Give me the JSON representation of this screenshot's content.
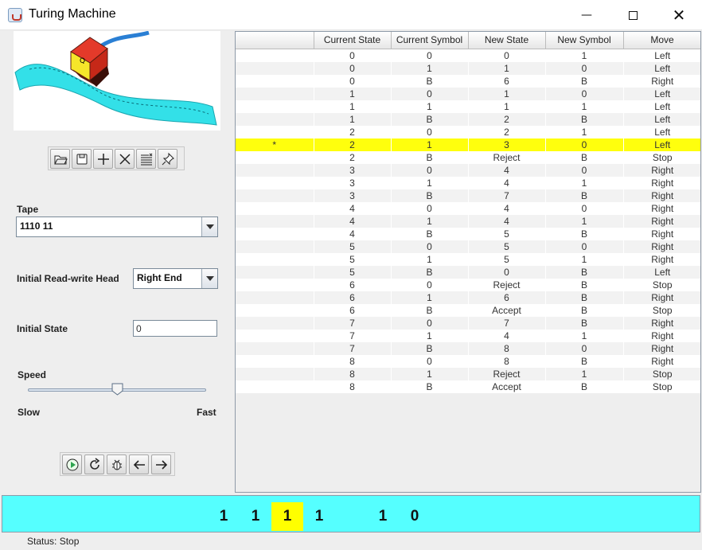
{
  "window": {
    "title": "Turing Machine",
    "minimize_glyph": "—",
    "close_glyph": "✕"
  },
  "toolbar": {
    "buttons": [
      "open-folder-icon",
      "save-icon",
      "add-icon",
      "delete-icon",
      "list-icon",
      "pin-icon"
    ]
  },
  "tape_field": {
    "label": "Tape",
    "value": "1110 11"
  },
  "head_field": {
    "label": "Initial Read-write Head",
    "value": "Right End"
  },
  "state_field": {
    "label": "Initial State",
    "value": "0"
  },
  "speed": {
    "label": "Speed",
    "min_label": "Slow",
    "max_label": "Fast",
    "value_fraction": 0.5
  },
  "controls": {
    "buttons": [
      "play-icon",
      "reset-icon",
      "debug-icon",
      "step-back-icon",
      "step-forward-icon"
    ]
  },
  "table": {
    "headers": [
      "",
      "Current State",
      "Current Symbol",
      "New State",
      "New Symbol",
      "Move"
    ],
    "highlighted_row": 7,
    "rows": [
      [
        "",
        "0",
        "0",
        "0",
        "1",
        "Left"
      ],
      [
        "",
        "0",
        "1",
        "1",
        "0",
        "Left"
      ],
      [
        "",
        "0",
        "B",
        "6",
        "B",
        "Right"
      ],
      [
        "",
        "1",
        "0",
        "1",
        "0",
        "Left"
      ],
      [
        "",
        "1",
        "1",
        "1",
        "1",
        "Left"
      ],
      [
        "",
        "1",
        "B",
        "2",
        "B",
        "Left"
      ],
      [
        "",
        "2",
        "0",
        "2",
        "1",
        "Left"
      ],
      [
        "*",
        "2",
        "1",
        "3",
        "0",
        "Left"
      ],
      [
        "",
        "2",
        "B",
        "Reject",
        "B",
        "Stop"
      ],
      [
        "",
        "3",
        "0",
        "4",
        "0",
        "Right"
      ],
      [
        "",
        "3",
        "1",
        "4",
        "1",
        "Right"
      ],
      [
        "",
        "3",
        "B",
        "7",
        "B",
        "Right"
      ],
      [
        "",
        "4",
        "0",
        "4",
        "0",
        "Right"
      ],
      [
        "",
        "4",
        "1",
        "4",
        "1",
        "Right"
      ],
      [
        "",
        "4",
        "B",
        "5",
        "B",
        "Right"
      ],
      [
        "",
        "5",
        "0",
        "5",
        "0",
        "Right"
      ],
      [
        "",
        "5",
        "1",
        "5",
        "1",
        "Right"
      ],
      [
        "",
        "5",
        "B",
        "0",
        "B",
        "Left"
      ],
      [
        "",
        "6",
        "0",
        "Reject",
        "B",
        "Stop"
      ],
      [
        "",
        "6",
        "1",
        "6",
        "B",
        "Right"
      ],
      [
        "",
        "6",
        "B",
        "Accept",
        "B",
        "Stop"
      ],
      [
        "",
        "7",
        "0",
        "7",
        "B",
        "Right"
      ],
      [
        "",
        "7",
        "1",
        "4",
        "1",
        "Right"
      ],
      [
        "",
        "7",
        "B",
        "8",
        "0",
        "Right"
      ],
      [
        "",
        "8",
        "0",
        "8",
        "B",
        "Right"
      ],
      [
        "",
        "8",
        "1",
        "Reject",
        "1",
        "Stop"
      ],
      [
        "",
        "8",
        "B",
        "Accept",
        "B",
        "Stop"
      ]
    ]
  },
  "tape": {
    "cells": [
      "1",
      "1",
      "1",
      "1",
      "",
      "1",
      "0"
    ],
    "head_index": 2,
    "background_color": "#55ffff",
    "head_color": "#ffff00"
  },
  "status": {
    "text": "Status: Stop"
  },
  "illustration": {
    "head_letter": "Q"
  }
}
